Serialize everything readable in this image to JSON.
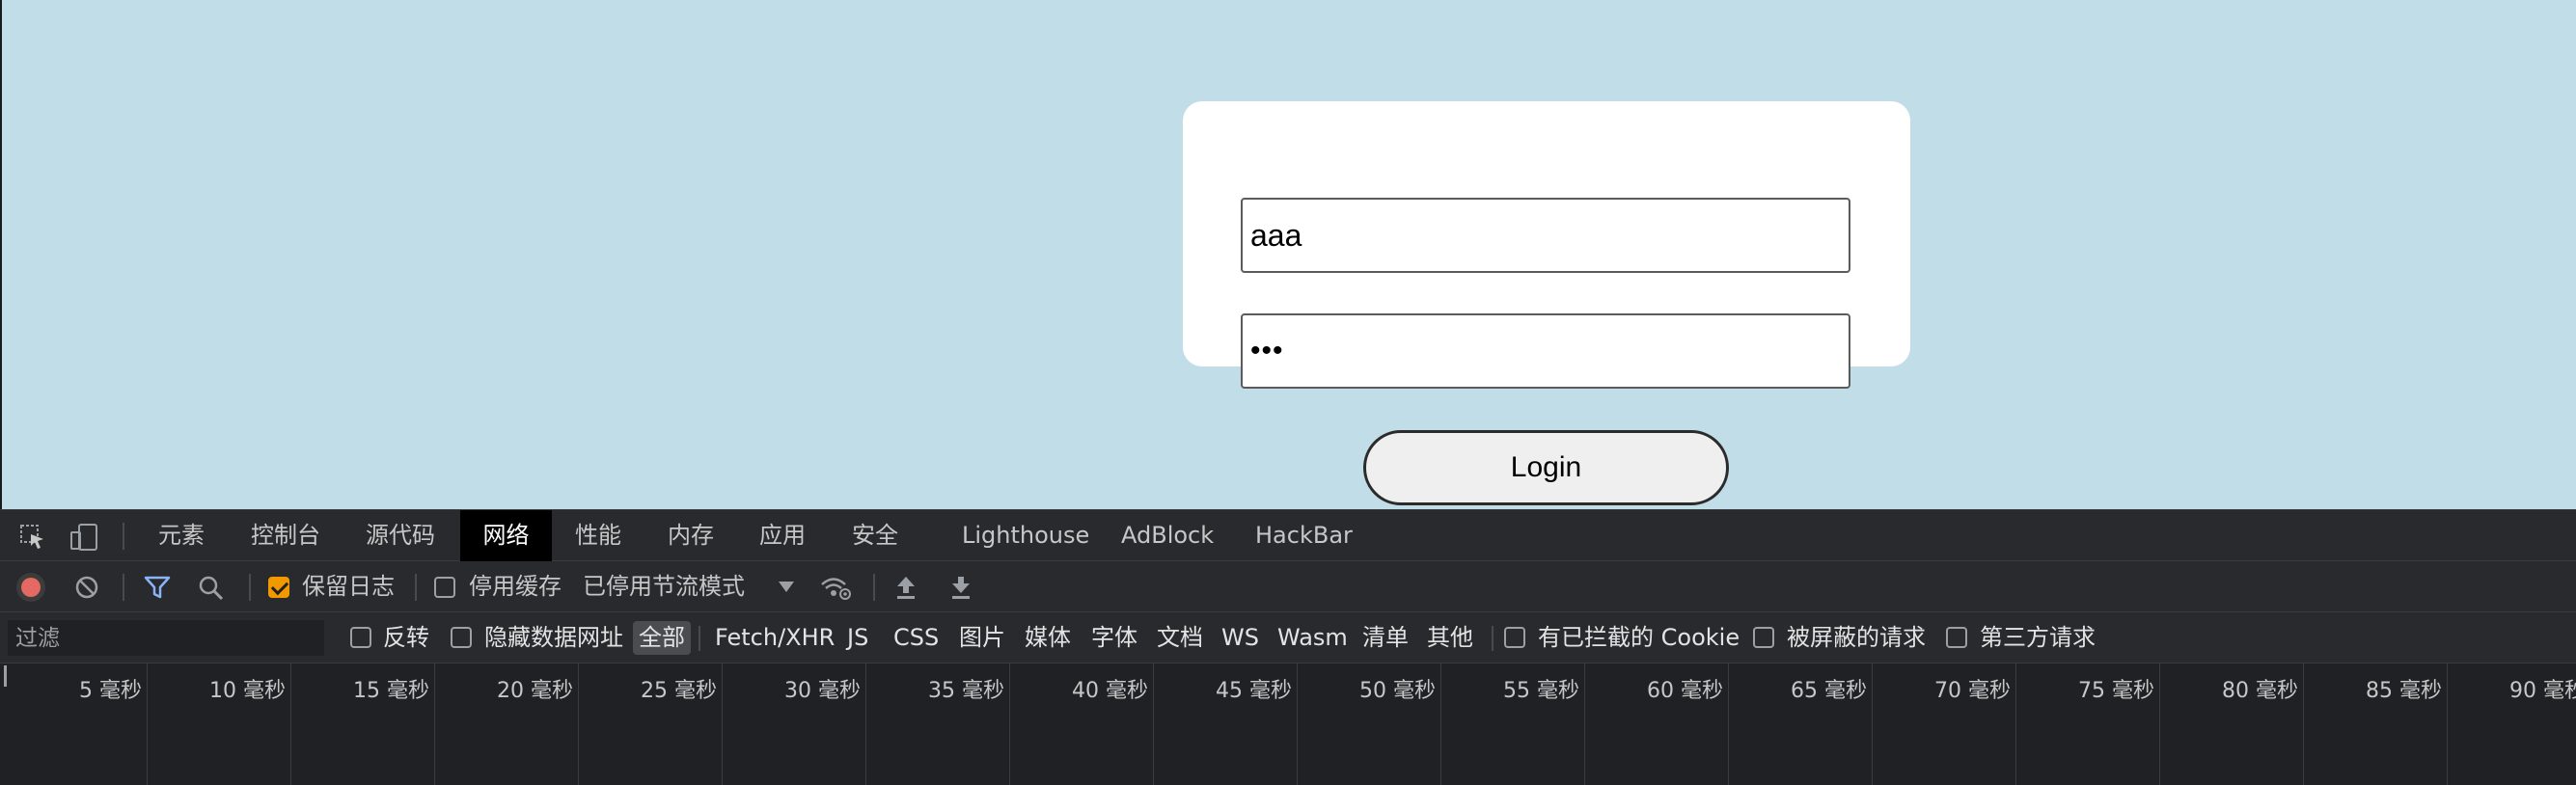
{
  "login_form": {
    "username_value": "aaa",
    "password_value": "•••",
    "login_label": "Login"
  },
  "devtools": {
    "tabs": [
      "元素",
      "控制台",
      "源代码",
      "网络",
      "性能",
      "内存",
      "应用",
      "安全",
      "Lighthouse",
      "AdBlock",
      "HackBar"
    ],
    "active_tab": "网络",
    "toolbar": {
      "preserve_log_label": "保留日志",
      "preserve_log_checked": true,
      "disable_cache_label": "停用缓存",
      "disable_cache_checked": false,
      "throttling_label": "已停用节流模式"
    },
    "filter_bar": {
      "placeholder": "过滤",
      "invert_label": "反转",
      "hide_data_urls_label": "隐藏数据网址",
      "types": [
        "全部",
        "Fetch/XHR",
        "JS",
        "CSS",
        "图片",
        "媒体",
        "字体",
        "文档",
        "WS",
        "Wasm",
        "清单",
        "其他"
      ],
      "selected_type": "全部",
      "blocked_cookies_label": "有已拦截的 Cookie",
      "blocked_requests_label": "被屏蔽的请求",
      "third_party_label": "第三方请求"
    },
    "timeline_ticks": [
      "5 毫秒",
      "10 毫秒",
      "15 毫秒",
      "20 毫秒",
      "25 毫秒",
      "30 毫秒",
      "35 毫秒",
      "40 毫秒",
      "45 毫秒",
      "50 毫秒",
      "55 毫秒",
      "60 毫秒",
      "65 毫秒",
      "70 毫秒",
      "75 毫秒",
      "80 毫秒",
      "85 毫秒",
      "90 毫秒"
    ]
  },
  "colors": {
    "page_background": "#c0dde8",
    "devtools_background": "#202124",
    "record_button": "#e46962",
    "filter_icon": "#8ab4f8",
    "checkbox_checked": "#f29900"
  }
}
